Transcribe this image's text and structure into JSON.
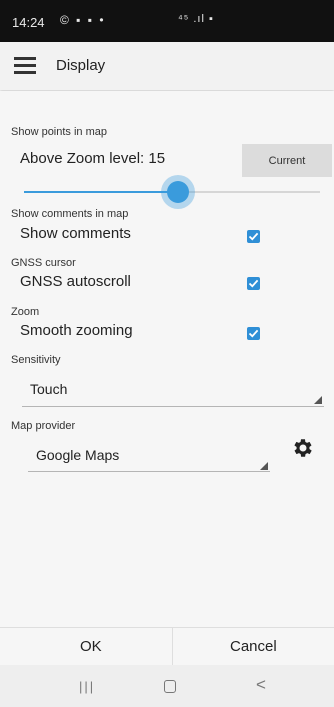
{
  "status_bar": {
    "time": "14:24",
    "left_icons": "© ▪ ▪ •",
    "right_icons": "⁴⁵ .ıl ▪"
  },
  "app_bar": {
    "title": "Display"
  },
  "show_points": {
    "section_label": "Show points in map",
    "zoom_text": "Above Zoom level: 15",
    "current_button": "Current",
    "slider_fraction": 0.52
  },
  "show_comments": {
    "section_label": "Show comments in map",
    "option_label": "Show comments",
    "checked": true
  },
  "gnss": {
    "section_label": "GNSS cursor",
    "option_label": "GNSS autoscroll",
    "checked": true
  },
  "zoom": {
    "section_label": "Zoom",
    "option_label": "Smooth zooming",
    "checked": true
  },
  "sensitivity": {
    "section_label": "Sensitivity",
    "selected": "Touch"
  },
  "map_provider": {
    "section_label": "Map provider",
    "selected": "Google Maps",
    "settings_icon": "gear-icon"
  },
  "dialog_buttons": {
    "ok": "OK",
    "cancel": "Cancel"
  },
  "nav_bar": {
    "recent": "|||",
    "back": "<"
  },
  "colors": {
    "accent": "#3a9bdc",
    "checkbox": "#2f8fd6"
  }
}
